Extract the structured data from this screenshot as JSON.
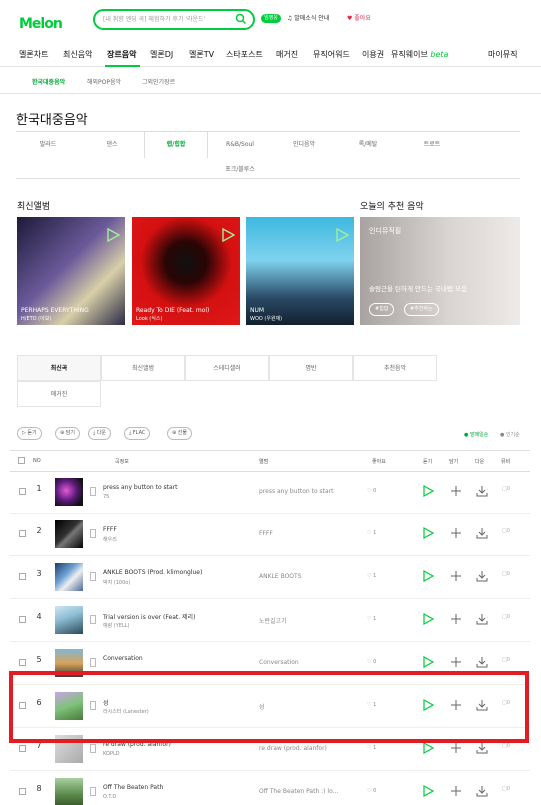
{
  "header": {
    "logo": "Melon",
    "search_placeholder": "[내 취향 엔딩 곡] 체험하기 후기 '라운드'",
    "badge": "임영웅",
    "text1": "♫ 발매소식 안내",
    "text2": "♥ 좋아요"
  },
  "gnb": {
    "items": [
      "멜론차트",
      "최신음악",
      "장르음악",
      "멜론DJ",
      "멜론TV",
      "스타포스트",
      "매거진",
      "뮤직어워드",
      "이용권",
      "뮤직웨이브",
      "마이뮤직"
    ],
    "beta": "beta"
  },
  "subnav": {
    "items": [
      "한국대중음악",
      "해외POP음악",
      "그외인기장르"
    ]
  },
  "page_title": "한국대중음악",
  "genre_tabs": [
    "발라드",
    "댄스",
    "랩/힙합",
    "R&B/Soul",
    "인디음악",
    "록/메탈",
    "트로트",
    "포크/블루스"
  ],
  "sections": {
    "new_albums": "최신앨범",
    "recommend": "오늘의 추천 음악"
  },
  "albums": [
    {
      "title": "PERHAPS EVERYTHING",
      "artist": "H/ETO (아보)"
    },
    {
      "title": "Ready To DIE (Feat. mol)",
      "artist": "Look (식스)"
    },
    {
      "title": "NUM",
      "artist": "WOO (우원재)"
    }
  ],
  "recommend": {
    "tag": "인디뮤직필",
    "desc": "슬럼근을 틴하게 만드는 국내랩 모음",
    "pill1": "#힙합",
    "pill2": "#추천하는"
  },
  "content_tabs": [
    "최신곡",
    "최신앨범",
    "스테디셀러",
    "명반",
    "추천음악",
    "매거진"
  ],
  "toolbar": {
    "buttons": [
      "▷ 듣기",
      "⊕ 담기",
      "⤓ 다운",
      "⤓ FLAC",
      "⊕ 선물"
    ],
    "right1": "● 발매일순",
    "right2": "● 인기순"
  },
  "table_headers": [
    "NO",
    "곡정보",
    "앨범",
    "좋아요",
    "듣기",
    "담기",
    "다운",
    "뮤비"
  ],
  "rows": [
    {
      "no": "1",
      "song": "press any button to start",
      "artist": "75",
      "album": "press any button to start",
      "likes": "♡ 0"
    },
    {
      "no": "2",
      "song": "FFFF",
      "artist": "해우리",
      "album": "FFFF",
      "likes": "♡ 1"
    },
    {
      "no": "3",
      "song": "ANKLE BOOTS (Prod. klimonglue)",
      "artist": "박지 (100o)",
      "album": "ANKLE BOOTS",
      "likes": "♡ 1"
    },
    {
      "no": "4",
      "song": "Trial version is over (Feat. 제리)",
      "artist": "예랑 (YELL)",
      "album": "노란길고기",
      "likes": "♡ 1"
    },
    {
      "no": "5",
      "song": "Conversation",
      "artist": "",
      "album": "Conversation",
      "likes": "♡ 0"
    },
    {
      "no": "6",
      "song": "성",
      "artist": "라시스터 (Lanester)",
      "album": "성",
      "likes": "♡ 1"
    },
    {
      "no": "7",
      "song": "re draw (prod. alanfor)",
      "artist": "KOPLD",
      "album": "re draw (prod. alanfor)",
      "likes": "♡ 1"
    },
    {
      "no": "8",
      "song": "Off The Beaten Path",
      "artist": "O.T.D",
      "album": "Off The Beaten Path :) lo...",
      "likes": "♡ 0"
    }
  ],
  "mv_label": "□0",
  "colors": {
    "accent": "#00cd3c",
    "highlight": "#e31b23"
  }
}
